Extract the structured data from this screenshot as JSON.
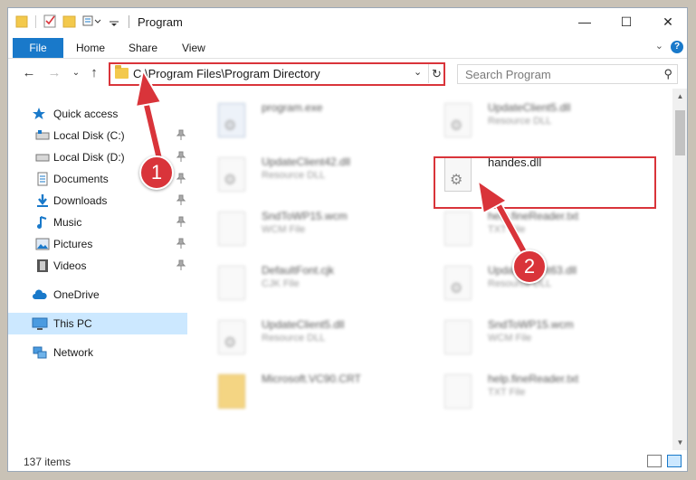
{
  "window": {
    "title": "Program",
    "controls": {
      "minimize": "—",
      "maximize": "☐",
      "close": "✕"
    }
  },
  "ribbon": {
    "tabs": [
      "File",
      "Home",
      "Share",
      "View"
    ],
    "help": "?",
    "collapse": "⌄"
  },
  "nav": {
    "back": "←",
    "forward": "→",
    "recent": "⌄",
    "up": "↑",
    "address": "C:\\Program Files\\Program Directory",
    "dropdown": "⌄",
    "refresh": "↻",
    "search_placeholder": "Search Program",
    "search_icon": "⚲"
  },
  "sidebar": {
    "items": [
      {
        "label": "Quick access",
        "icon": "star-icon",
        "pinned": false
      },
      {
        "label": "Local Disk (C:)",
        "icon": "disk-icon",
        "pinned": true
      },
      {
        "label": "Local Disk (D:)",
        "icon": "disk-icon",
        "pinned": true
      },
      {
        "label": "Documents",
        "icon": "documents-icon",
        "pinned": true
      },
      {
        "label": "Downloads",
        "icon": "downloads-icon",
        "pinned": true
      },
      {
        "label": "Music",
        "icon": "music-icon",
        "pinned": true
      },
      {
        "label": "Pictures",
        "icon": "pictures-icon",
        "pinned": true
      },
      {
        "label": "Videos",
        "icon": "videos-icon",
        "pinned": true
      },
      {
        "label": "OneDrive",
        "icon": "cloud-icon",
        "pinned": false
      },
      {
        "label": "This PC",
        "icon": "computer-icon",
        "pinned": false,
        "selected": true
      },
      {
        "label": "Network",
        "icon": "network-icon",
        "pinned": false
      }
    ],
    "pin_glyph": "📌"
  },
  "files": [
    {
      "name": "program.exe",
      "type": "",
      "icon": "exe"
    },
    {
      "name": "UpdateClient5.dll",
      "type": "Resource DLL",
      "icon": "dll"
    },
    {
      "name": "UpdateClient42.dll",
      "type": "Resource DLL",
      "icon": "dll"
    },
    {
      "name": "handes.dll",
      "type": "",
      "icon": "dll"
    },
    {
      "name": "SndToWP15.wcm",
      "type": "WCM File",
      "icon": "plain"
    },
    {
      "name": "help.fineReader.txt",
      "type": "TXT File",
      "icon": "plain"
    },
    {
      "name": "DefaultFont.cjk",
      "type": "CJK File",
      "icon": "plain"
    },
    {
      "name": "UpdateClient63.dll",
      "type": "Resource DLL",
      "icon": "dll"
    },
    {
      "name": "UpdateClient5.dll",
      "type": "Resource DLL",
      "icon": "dll"
    },
    {
      "name": "SndToWP15.wcm",
      "type": "WCM File",
      "icon": "plain"
    },
    {
      "name": "Microsoft.VC90.CRT",
      "type": "",
      "icon": "folder"
    },
    {
      "name": "help.fineReader.txt",
      "type": "TXT File",
      "icon": "plain"
    }
  ],
  "callouts": [
    "1",
    "2"
  ],
  "status": {
    "item_count": "137 items"
  },
  "colors": {
    "accent": "#1979ca",
    "highlight": "#d9343a",
    "selected": "#cce8ff"
  }
}
